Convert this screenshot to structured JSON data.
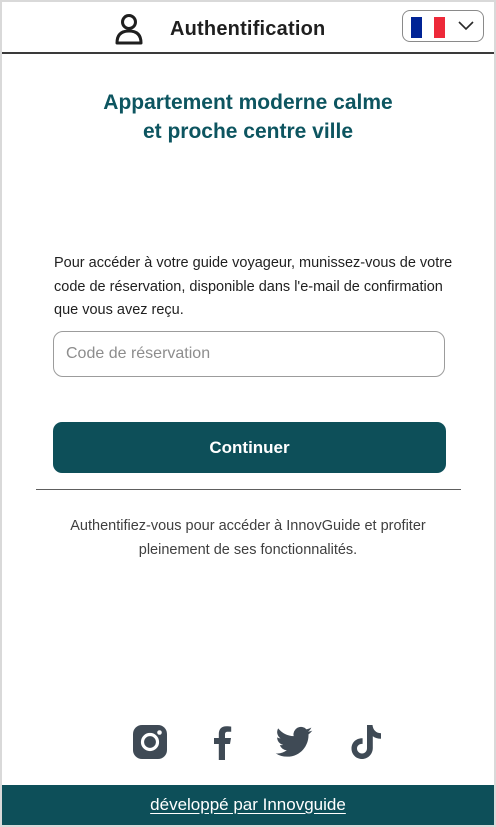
{
  "header": {
    "title": "Authentification",
    "user_icon": "user-icon",
    "language": {
      "selected": "Français",
      "flag_colors": [
        "#002395",
        "#ffffff",
        "#ed2939"
      ],
      "icon": "chevron-down-icon"
    }
  },
  "main": {
    "property_title": [
      "Appartement moderne calme",
      "et proche centre ville"
    ],
    "intro_text": "Pour accéder à votre guide voyageur, munissez-vous de votre code de réservation, disponible dans l'e-mail de confirmation que vous avez reçu.",
    "reservation_input": {
      "placeholder": "Code de réservation",
      "value": ""
    },
    "continue_label": "Continuer",
    "auth_info": "Authentifiez-vous pour accéder à InnovGuide et profiter pleinement de ses fonctionnalités."
  },
  "social": [
    "instagram-icon",
    "facebook-icon",
    "twitter-icon",
    "tiktok-icon"
  ],
  "footer": {
    "credit": "développé par Innovguide"
  },
  "colors": {
    "brand": "#0d4f59",
    "title": "#0d5560",
    "social_icon": "#3f4a55"
  }
}
